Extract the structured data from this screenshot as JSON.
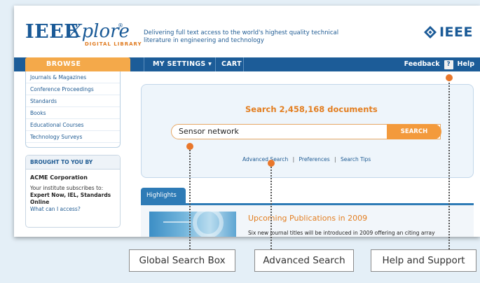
{
  "header": {
    "logo_ieee": "IEEE",
    "logo_xplore": "Xplore",
    "logo_reg": "®",
    "logo_sub": "DIGITAL LIBRARY",
    "tagline": "Delivering full text access to the world's highest quality technical literature in engineering and technology",
    "brand": "IEEE",
    "brand_icon": "ieee-diamond-icon"
  },
  "nav": {
    "browse": "BROWSE",
    "my_settings": "MY SETTINGS ▾",
    "cart": "CART",
    "feedback": "Feedback",
    "help_icon": "?",
    "help": "Help"
  },
  "sidebar": {
    "items": [
      {
        "label": "Journals & Magazines"
      },
      {
        "label": "Conference Proceedings"
      },
      {
        "label": "Standards"
      },
      {
        "label": "Books"
      },
      {
        "label": "Educational Courses"
      },
      {
        "label": "Technology Surveys"
      }
    ]
  },
  "brought": {
    "heading": "BROUGHT TO YOU BY",
    "org": "ACME Corporation",
    "text": "Your institute subscribes to:",
    "subs": "Expert Now, IEL, Standards Online",
    "link": "What can I access?"
  },
  "search": {
    "title": "Search 2,458,168 documents",
    "value": "Sensor network",
    "button": "SEARCH",
    "advanced": "Advanced Search",
    "sep1": "|",
    "preferences": "Preferences",
    "sep2": "|",
    "tips": "Search Tips"
  },
  "highlights": {
    "tab": "Highlights",
    "title": "Upcoming Publications in 2009",
    "desc": "Six new journal titles will be introduced in 2009 offering an citing array"
  },
  "callouts": {
    "search_box": "Global Search Box",
    "advanced": "Advanced Search",
    "help": "Help and Support"
  },
  "colors": {
    "brand_blue": "#1a5a97",
    "nav_blue": "#1c5c98",
    "accent_orange": "#f39a3c",
    "callout_dot": "#e9772b"
  }
}
